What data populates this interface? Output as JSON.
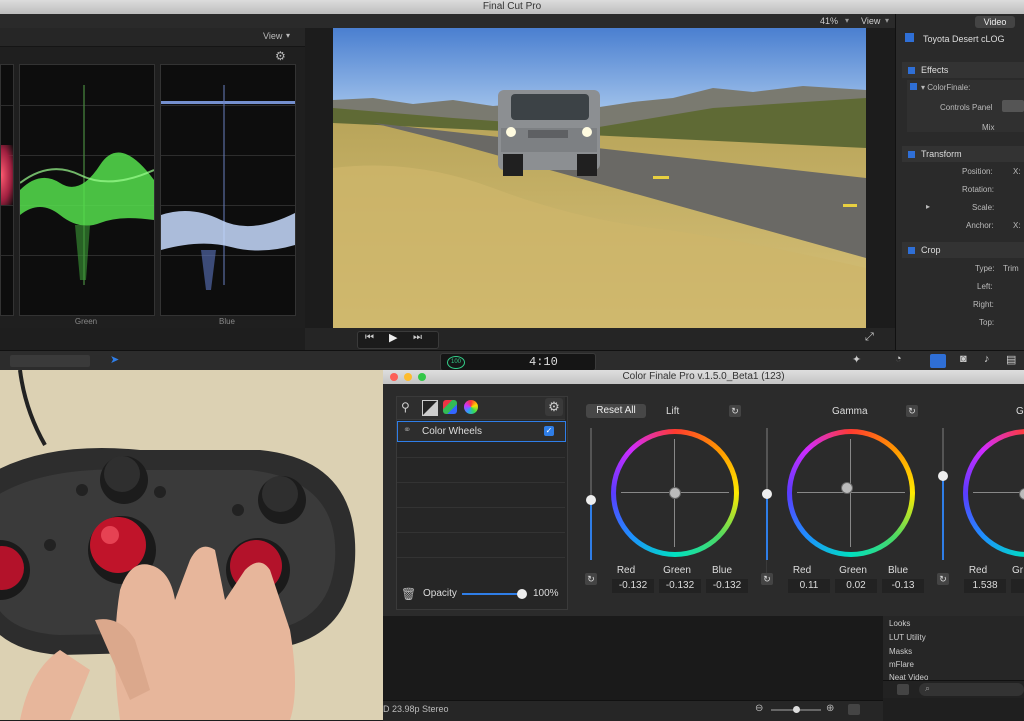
{
  "app": {
    "title": "Final Cut Pro"
  },
  "scopes": {
    "view_label": "View",
    "labels": [
      "Green",
      "Blue"
    ]
  },
  "viewer": {
    "zoom": "41%",
    "view_label": "View",
    "timecode": "4:10",
    "tc_badge": "100"
  },
  "inspector": {
    "tab": "Video",
    "clip": "Toyota Desert cLOG",
    "effects": "Effects",
    "colorfinale": "ColorFinale:",
    "controls_panel": "Controls Panel",
    "mix": "Mix",
    "transform": "Transform",
    "position": "Position:",
    "rotation": "Rotation:",
    "scale": "Scale:",
    "anchor": "Anchor:",
    "x_label": "X:",
    "crop": "Crop",
    "type": "Type:",
    "type_value": "Trim",
    "left": "Left:",
    "right": "Right:",
    "top": "Top:"
  },
  "colorfinale": {
    "title": "Color Finale Pro v.1.5.0_Beta1 (123)",
    "reset_all": "Reset All",
    "layer": "Color Wheels",
    "opacity_label": "Opacity",
    "opacity_value": "100%",
    "opacity_fraction": 1.0,
    "wheels": [
      {
        "name": "Lift",
        "red": "-0.132",
        "green": "-0.132",
        "blue": "-0.132"
      },
      {
        "name": "Gamma",
        "red": "0.11",
        "green": "0.02",
        "blue": "-0.13"
      },
      {
        "name": "G",
        "red": "1.538",
        "green": "Gr"
      }
    ],
    "rgb_labels": {
      "red": "Red",
      "green": "Green",
      "blue": "Blue"
    },
    "reset_glyph": "↻"
  },
  "browser": {
    "items": [
      "Looks",
      "LUT Utility",
      "Masks",
      "mFlare",
      "Neat Video"
    ]
  },
  "timeline": {
    "status": "D 23.98p Stereo"
  },
  "colors": {
    "accent": "#2f7ee8",
    "checkbox": "#2f6fd6"
  }
}
